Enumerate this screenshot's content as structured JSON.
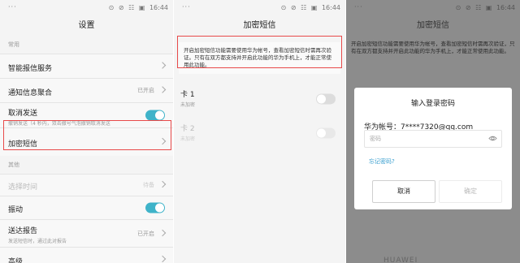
{
  "status_bar": {
    "dots": "···",
    "icons": [
      "⊙",
      "⊘",
      "☷",
      "▣"
    ],
    "time": "16:44"
  },
  "settings": {
    "title": "设置",
    "section_common": "常用",
    "section_other": "其他",
    "items": [
      {
        "label": "智能报信服务"
      },
      {
        "label": "通知信息聚合",
        "value": "已开启"
      },
      {
        "label": "取消发送",
        "sub": "撤销发送（4 秒内，双击撤号气泡撤销取消发送"
      },
      {
        "label": "加密短信"
      },
      {
        "label": "选择时间",
        "value": "待备"
      },
      {
        "label": "振动"
      },
      {
        "label": "送达报告",
        "sub": "发送短信时，通过此对报告",
        "value": "已开启"
      },
      {
        "label": "高级"
      }
    ]
  },
  "encrypt": {
    "title": "加密短信",
    "notice": "开启加密短信功能需要使用华为帐号，查看加密短信时需再次验证。只有在双方都支持并开启此功能的华为手机上，才能正常使用此功能。",
    "cards": [
      {
        "label": "卡 1",
        "sub": "未加密"
      },
      {
        "label": "卡 2",
        "sub": "未加密"
      }
    ]
  },
  "dialog_screen": {
    "title": "加密短信",
    "notice": "开启加密短信功能需要使用华为帐号，查看加密短信时需再次验证，只有在双方都支持并开启此功能的华为手机上，才能正常使用此功能。",
    "dialog": {
      "title": "输入登录密码",
      "account": "华为帐号：7****7320@qq.com",
      "placeholder": "密码",
      "forgot": "忘记密码?",
      "cancel": "取消",
      "ok": "确定"
    },
    "logo": "HUAWEI"
  },
  "colors": {
    "accent": "#3fb3c9",
    "highlight": "#e84a4a",
    "link": "#3a9fcf"
  }
}
